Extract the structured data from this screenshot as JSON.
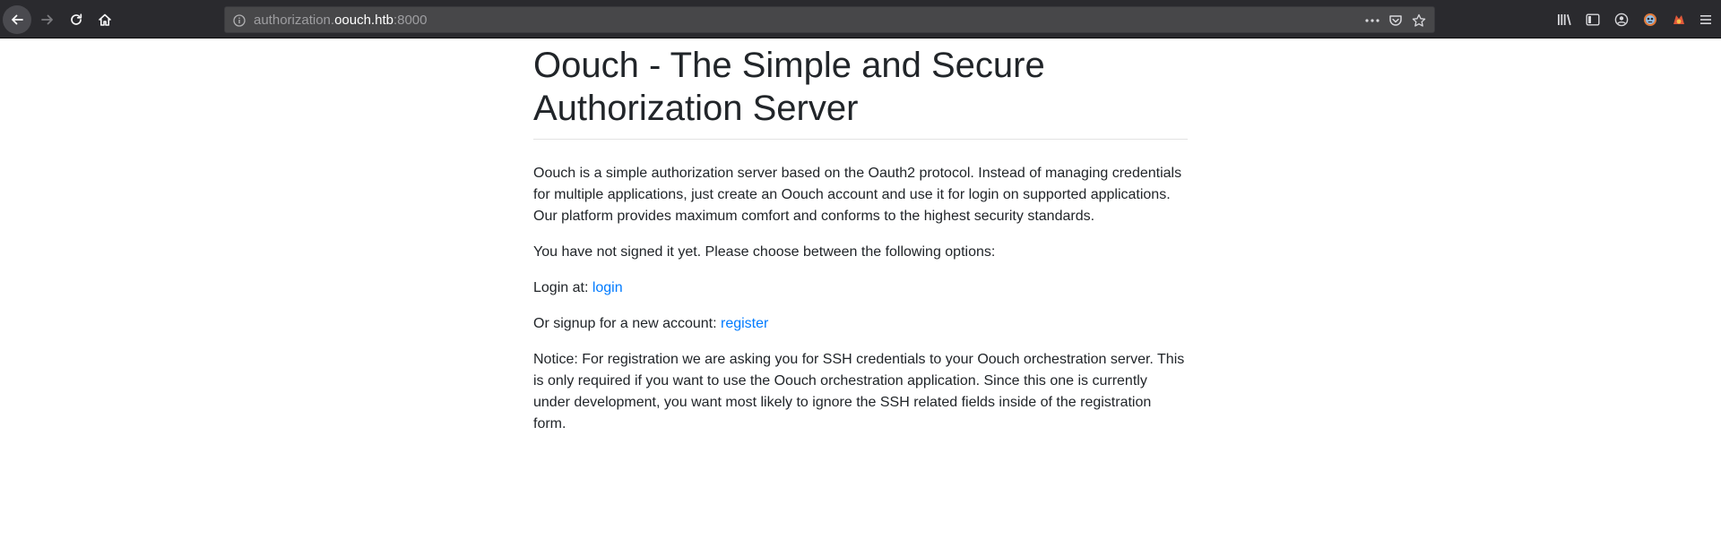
{
  "browser": {
    "url_prefix": "authorization.",
    "url_host": "oouch.htb",
    "url_suffix": ":8000"
  },
  "page": {
    "title": "Oouch - The Simple and Secure Authorization Server",
    "intro": "Oouch is a simple authorization server based on the Oauth2 protocol. Instead of managing credentials for multiple applications, just create an Oouch account and use it for login on supported applications. Our platform provides maximum comfort and conforms to the highest security standards.",
    "status": "You have not signed it yet. Please choose between the following options:",
    "login_prefix": "Login at: ",
    "login_link": "login",
    "signup_prefix": "Or signup for a new account: ",
    "register_link": "register",
    "notice": "Notice: For registration we are asking you for SSH credentials to your Oouch orchestration server. This is only required if you want to use the Oouch orchestration application. Since this one is currently under development, you want most likely to ignore the SSH related fields inside of the registration form."
  },
  "colors": {
    "toolbar_bg": "#2a2a2e",
    "urlbar_bg": "#474749",
    "link": "#007bff",
    "text": "#212529"
  },
  "icons": {
    "nav": [
      "back-arrow-icon",
      "forward-arrow-icon",
      "reload-icon",
      "home-icon"
    ],
    "url": [
      "info-icon",
      "more-dots-icon",
      "pocket-icon",
      "bookmark-star-icon"
    ],
    "tools": [
      "library-icon",
      "sidebar-icon",
      "account-icon",
      "extension-icon",
      "firefox-extension-icon",
      "hamburger-menu-icon"
    ]
  }
}
